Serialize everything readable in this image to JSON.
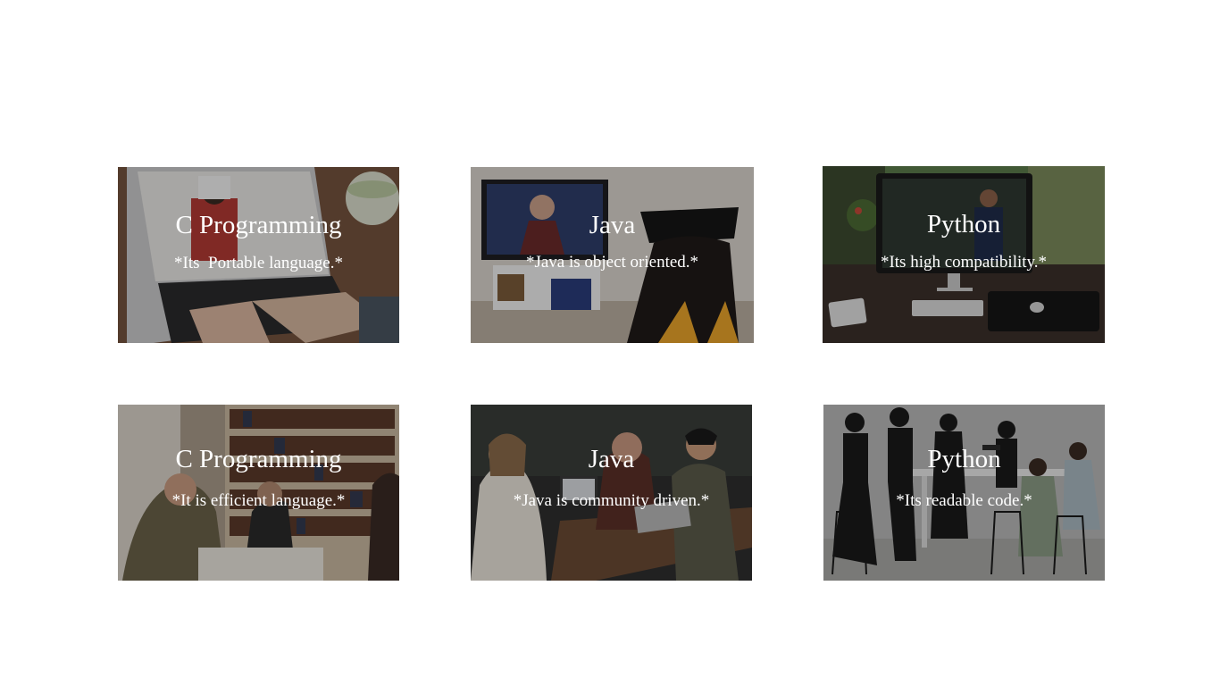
{
  "cards": [
    {
      "title": "C Programming",
      "caption": "*Its  Portable language.*",
      "image": "laptop-video-call-photo"
    },
    {
      "title": "Java",
      "caption": "*Java is object oriented.*",
      "image": "graduate-watching-tv-photo"
    },
    {
      "title": "Python",
      "caption": "*Its high compatibility.*",
      "image": "desktop-monitor-lecture-photo"
    },
    {
      "title": "C Programming",
      "caption": "*It is efficient language.*",
      "image": "library-students-photo"
    },
    {
      "title": "Java",
      "caption": "*Java is community driven.*",
      "image": "cafe-laptop-group-photo"
    },
    {
      "title": "Python",
      "caption": "*Its readable code.*",
      "image": "team-standing-meeting-photo"
    }
  ],
  "colors": {
    "background": "#ffffff",
    "text": "#ffffff"
  }
}
